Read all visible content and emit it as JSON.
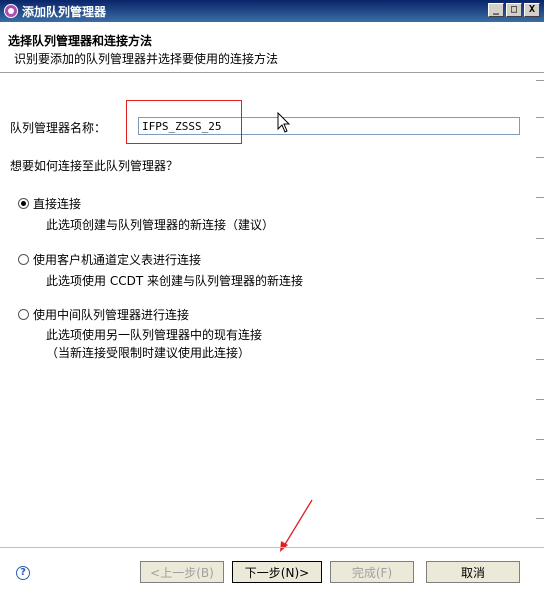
{
  "window": {
    "title": "添加队列管理器",
    "minimize": "_",
    "maximize": "□",
    "close": "X"
  },
  "header": {
    "title": "选择队列管理器和连接方法",
    "description": "识别要添加的队列管理器并选择要使用的连接方法"
  },
  "form": {
    "qm_label": "队列管理器名称：",
    "qm_value": "IFPS_ZSSS_25",
    "question": "想要如何连接至此队列管理器？"
  },
  "options": [
    {
      "label": "直接连接",
      "desc": [
        "此选项创建与队列管理器的新连接（建议）"
      ],
      "checked": true
    },
    {
      "label": "使用客户机通道定义表进行连接",
      "desc": [
        "此选项使用 CCDT 来创建与队列管理器的新连接"
      ],
      "checked": false
    },
    {
      "label": "使用中间队列管理器进行连接",
      "desc": [
        "此选项使用另一队列管理器中的现有连接",
        "（当新连接受限制时建议使用此连接）"
      ],
      "checked": false
    }
  ],
  "buttons": {
    "help": "?",
    "back": "<上一步(B)",
    "next": "下一步(N)>",
    "finish": "完成(F)",
    "cancel": "取消"
  },
  "colors": {
    "annotation": "#e02020",
    "titlebar": "#0a246a"
  }
}
